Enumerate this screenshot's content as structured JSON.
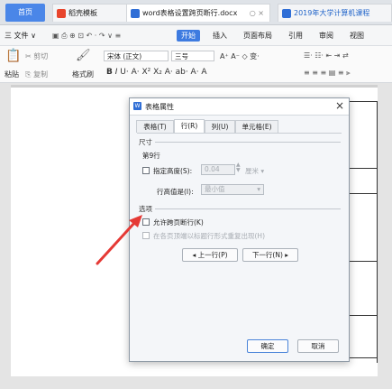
{
  "tabs": {
    "home": "首页",
    "docer": "稻壳模板",
    "doc1": "word表格设置跨页断行.docx",
    "doc2": "2019年大学计算机课程"
  },
  "menu": {
    "file": "三 文件 ∨",
    "start": "开始",
    "insert": "插入",
    "layout": "页面布局",
    "reference": "引用",
    "review": "审阅",
    "view": "视图"
  },
  "ribbon": {
    "paste": "粘贴",
    "cut": "剪切",
    "copy": "复制",
    "format_painter": "格式刷",
    "font_name": "宋体 (正文)",
    "font_size": "三号"
  },
  "dialog": {
    "title": "表格属性",
    "tabs": [
      "表格(T)",
      "行(R)",
      "列(U)",
      "单元格(E)"
    ],
    "size_section": "尺寸",
    "row_label": "第9行",
    "specify_height_label": "指定高度(S):",
    "height_value": "0.04",
    "unit": "厘米",
    "row_height_label": "行高值是(I):",
    "row_height_value": "最小值",
    "options_section": "选项",
    "allow_break_label": "允许跨页断行(K)",
    "repeat_header_label": "在各页顶端以标题行形式重复出现(H)",
    "prev_row": "上一行(P)",
    "next_row": "下一行(N)",
    "ok": "确定",
    "cancel": "取消"
  },
  "colors": {
    "accent": "#3e7be0",
    "arrow": "#e53935"
  }
}
